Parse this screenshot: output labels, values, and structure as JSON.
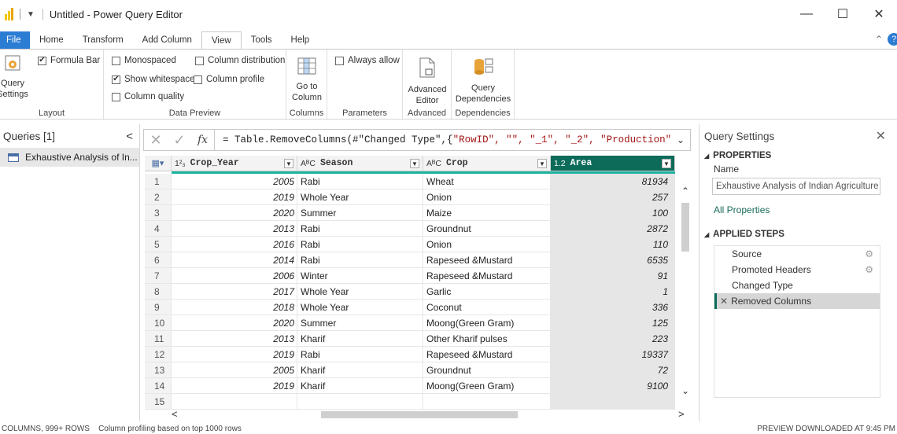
{
  "window": {
    "title": "Untitled - Power Query Editor",
    "minimize": "—",
    "maximize": "☐",
    "close": "✕"
  },
  "tabs": [
    "File",
    "Home",
    "Transform",
    "Add Column",
    "View",
    "Tools",
    "Help"
  ],
  "ribbon": {
    "layout": {
      "query_settings": "Query Settings",
      "formula_bar": "Formula Bar",
      "label": "Layout"
    },
    "data_preview": {
      "monospaced": "Monospaced",
      "show_whitespace": "Show whitespace",
      "column_quality": "Column quality",
      "column_distribution": "Column distribution",
      "column_profile": "Column profile",
      "label": "Data Preview"
    },
    "columns": {
      "go_to_column": "Go to Column",
      "label": "Columns"
    },
    "parameters": {
      "always_allow": "Always allow",
      "label": "Parameters"
    },
    "advanced": {
      "advanced_editor": "Advanced Editor",
      "label": "Advanced"
    },
    "dependencies": {
      "query_dependencies": "Query Dependencies",
      "label": "Dependencies"
    }
  },
  "queries": {
    "header": "Queries [1]",
    "items": [
      "Exhaustive Analysis of In..."
    ]
  },
  "formula": {
    "prefix": "= Table.RemoveColumns(#\"Changed Type\",{",
    "strings": "\"RowID\", \"\", \"_1\", \"_2\", \"Production\","
  },
  "grid": {
    "columns": [
      {
        "type": "1²₃",
        "name": "Crop_Year"
      },
      {
        "type": "AᴮC",
        "name": "Season"
      },
      {
        "type": "AᴮC",
        "name": "Crop"
      },
      {
        "type": "1.2",
        "name": "Area"
      }
    ],
    "rows": [
      [
        "1",
        "2005",
        "Rabi",
        "Wheat",
        "81934"
      ],
      [
        "2",
        "2019",
        "Whole Year",
        "Onion",
        "257"
      ],
      [
        "3",
        "2020",
        "Summer",
        "Maize",
        "100"
      ],
      [
        "4",
        "2013",
        "Rabi",
        "Groundnut",
        "2872"
      ],
      [
        "5",
        "2016",
        "Rabi",
        "Onion",
        "110"
      ],
      [
        "6",
        "2014",
        "Rabi",
        "Rapeseed &Mustard",
        "6535"
      ],
      [
        "7",
        "2006",
        "Winter",
        "Rapeseed &Mustard",
        "91"
      ],
      [
        "8",
        "2017",
        "Whole Year",
        "Garlic",
        "1"
      ],
      [
        "9",
        "2018",
        "Whole Year",
        "Coconut",
        "336"
      ],
      [
        "10",
        "2020",
        "Summer",
        "Moong(Green Gram)",
        "125"
      ],
      [
        "11",
        "2013",
        "Kharif",
        "Other Kharif pulses",
        "223"
      ],
      [
        "12",
        "2019",
        "Rabi",
        "Rapeseed &Mustard",
        "19337"
      ],
      [
        "13",
        "2005",
        "Kharif",
        "Groundnut",
        "72"
      ],
      [
        "14",
        "2019",
        "Kharif",
        "Moong(Green Gram)",
        "9100"
      ],
      [
        "15",
        "",
        "",
        "",
        ""
      ]
    ]
  },
  "settings": {
    "title": "Query Settings",
    "properties": "PROPERTIES",
    "name_label": "Name",
    "name_value": "Exhaustive Analysis of Indian Agriculture",
    "all_properties": "All Properties",
    "applied_steps": "APPLIED STEPS",
    "steps": [
      "Source",
      "Promoted Headers",
      "Changed Type",
      "Removed Columns"
    ]
  },
  "status": {
    "left": "COLUMNS, 999+ ROWS    Column profiling based on top 1000 rows",
    "right": "PREVIEW DOWNLOADED AT 9:45 PM"
  },
  "colors": {
    "accent": "#0d6b5a",
    "file_tab": "#2b7cd3",
    "quality_bar": "#1fb2a0"
  }
}
